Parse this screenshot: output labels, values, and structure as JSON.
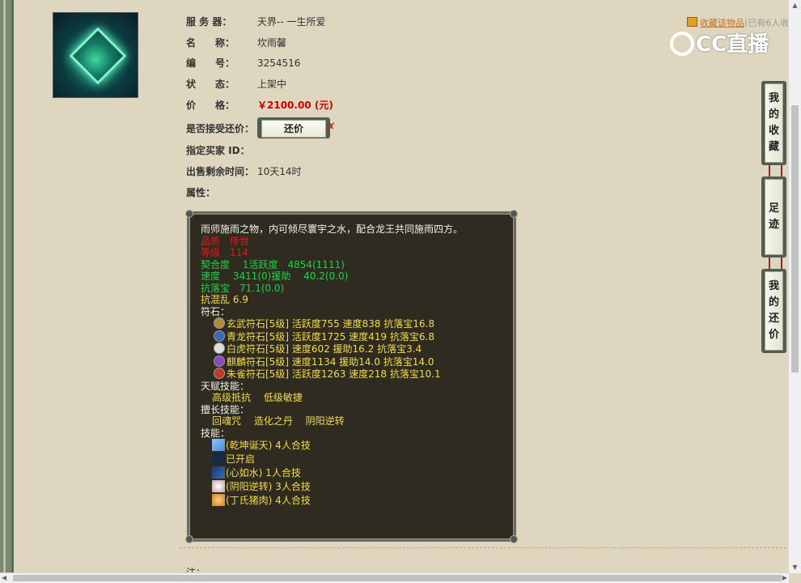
{
  "fields": {
    "server": {
      "label": "服 务 器：",
      "value": "天界-- 一生所爱"
    },
    "name": {
      "label": "名　　称：",
      "value": "坎雨馨"
    },
    "number": {
      "label": "编　　号：",
      "value": "3254516"
    },
    "status": {
      "label": "状　　态：",
      "value": "上架中"
    },
    "price": {
      "label": "价　　格：",
      "value": "￥2100.00 (元)"
    },
    "counter": {
      "label": "是否接受还价：",
      "button": "还价"
    },
    "buyer": {
      "label": "指定买家 ID："
    },
    "remaining": {
      "label": "出售剩余时间：",
      "value": "10天14时"
    },
    "attrs": {
      "label": "属性："
    }
  },
  "favorite": {
    "link": "收藏该物品",
    "count": "(已有6人收"
  },
  "watermark": "CC直播",
  "side_tabs": [
    {
      "chars": [
        "我",
        "的",
        "收",
        "藏"
      ]
    },
    {
      "chars": [
        "足",
        "迹"
      ]
    },
    {
      "chars": [
        "我",
        "的",
        "还",
        "价"
      ]
    }
  ],
  "attributes": {
    "desc": "雨师施雨之物，内可倾尽寰宇之水，配合龙王共同施雨四方。",
    "quality": "品质　传世",
    "level": "等级　114",
    "fit": "契合度　 1活跃度　4854(1111)",
    "speed": "速度　 3411(0)援助　 40.2(0.0)",
    "resist": "抗落宝　71.1(0.0)",
    "confuse": "抗混乱 6.9",
    "runes_label": "符石：",
    "runes": [
      {
        "text": "玄武符石[5级] 活跃度755 速度838 抗落宝16.8",
        "color": "#b08a3a"
      },
      {
        "text": "青龙符石[5级] 活跃度1725 速度419 抗落宝6.8",
        "color": "#3a6ab0"
      },
      {
        "text": "白虎符石[5级] 速度602 援助16.2 抗落宝3.4",
        "color": "#dddddd"
      },
      {
        "text": "麒麟符石[5级] 速度1134 援助14.0 抗落宝14.0",
        "color": "#8a4ab8"
      },
      {
        "text": "朱雀符石[5级] 活跃度1263 速度218 抗落宝10.1",
        "color": "#c03a2a"
      }
    ],
    "talent_label": "天赋技能：",
    "talents": "高级抵抗　 低级敏捷",
    "special_label": "擅长技能：",
    "specials": "回魂咒　 造化之丹　 阴阳逆转",
    "skills_label": "技能：",
    "skills": [
      {
        "text": "(乾坤诞天) 4人合技",
        "color": "#4a88c8"
      },
      {
        "text": "已开启",
        "color": "#1a2a40"
      },
      {
        "text": "(心如水) 1人合技",
        "color": "#3a6ab0"
      },
      {
        "text": "(阴阳逆转) 3人合技",
        "color": "#c0a0a0"
      },
      {
        "text": "(丁氏猪肉) 4人合技",
        "color": "#d07a20"
      }
    ]
  },
  "note_label": "注："
}
